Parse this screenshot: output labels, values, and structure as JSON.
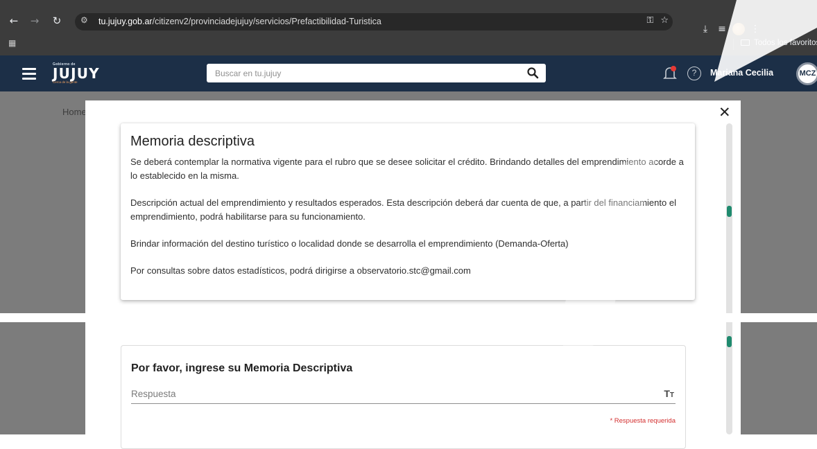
{
  "browser": {
    "url_host": "tu.jujuy.gob.ar",
    "url_path": "/citizenv2/provinciadejujuy/servicios/Prefactibilidad-Turistica",
    "bookmarks_folder": "Todos los favoritos"
  },
  "header": {
    "logo_small": "Gobierno de",
    "logo_main": "JUJUY",
    "logo_tagline": "Cerca de la gente",
    "search_placeholder": "Buscar en tu.jujuy",
    "user_name": "Mariana Cecilia",
    "user_initials": "MCZ"
  },
  "breadcrumb": {
    "home": "Home"
  },
  "modal": {
    "memoria": {
      "title": "Memoria descriptiva",
      "paragraphs": [
        "Se deberá contemplar la normativa vigente para el rubro que se desee solicitar el crédito. Brindando detalles del emprendimiento acorde a lo establecido en la misma.",
        "Descripción actual del emprendimiento y resultados esperados. Esta descripción deberá dar cuenta de que, a partir del financiamiento el emprendimiento, podrá habilitarse para su funcionamiento.",
        "Brindar información del destino turístico o localidad donde se desarrolla el emprendimiento (Demanda-Oferta)",
        "Por consultas sobre datos estadísticos, podrá dirigirse a observatorio.stc@gmail.com"
      ]
    },
    "question": {
      "title": "Por favor, ingrese su Memoria Descriptiva",
      "placeholder": "Respuesta",
      "required_note": "* Respuesta requerida"
    }
  },
  "colors": {
    "app_header": "#1c2f47",
    "scroll_thumb": "#1f8a6e",
    "required": "#d32f2f"
  },
  "icons": [
    "back-icon",
    "forward-icon",
    "reload-icon",
    "site-settings-icon",
    "password-key-icon",
    "star-icon",
    "download-icon",
    "reading-list-icon",
    "profile-icon",
    "menu-dots-icon",
    "apps-icon",
    "folder-icon",
    "hamburger-icon",
    "search-icon",
    "bell-icon",
    "help-icon",
    "close-icon",
    "text-format-icon"
  ]
}
